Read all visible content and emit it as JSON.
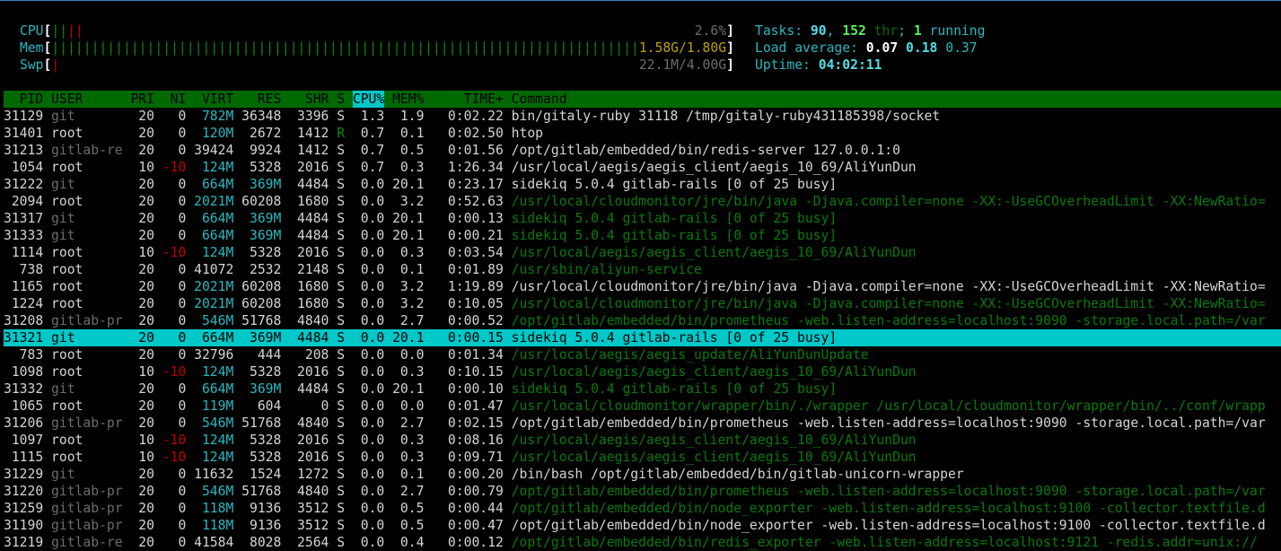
{
  "meters": [
    {
      "label": "CPU",
      "value_text": "2.6%",
      "segments": [
        {
          "percent": 1.3,
          "color": "#0a8a0a"
        },
        {
          "percent": 1.3,
          "color": "#c00000"
        }
      ]
    },
    {
      "label": "Mem",
      "value_text": "1.58G/1.80G",
      "segments": [
        {
          "percent": 88,
          "color": "#0a8a0a"
        },
        {
          "percent": 2,
          "color": "#3a78d0"
        },
        {
          "percent": 9.3,
          "color": "#c0a000"
        }
      ]
    },
    {
      "label": "Swp",
      "value_text": "22.1M/4.00G",
      "segments": [
        {
          "percent": 0.54,
          "color": "#c00000"
        }
      ]
    }
  ],
  "summary": {
    "tasks_label": "Tasks: ",
    "tasks": "90",
    "sep1": ", ",
    "threads": "152",
    "thr_label": " thr",
    "sep2": "; ",
    "running": "1",
    "running_label": " running",
    "load_label": "Load average: ",
    "load1": "0.07",
    "load5": "0.18",
    "load15": "0.37",
    "uptime_label": "Uptime: ",
    "uptime": "04:02:11"
  },
  "columns": {
    "pid": "PID",
    "user": "USER",
    "pri": "PRI",
    "ni": "NI",
    "virt": "VIRT",
    "res": "RES",
    "shr": "SHR",
    "s": "S",
    "cpu": "CPU%",
    "mem": "MEM%",
    "time": "TIME+",
    "cmd": "Command"
  },
  "sorted_column": "cpu",
  "rows": [
    {
      "pid": "31129",
      "user": "git",
      "pri": "20",
      "ni": "0",
      "virt": "782M",
      "res": "36348",
      "shr": "3396",
      "s": "S",
      "cpu": "1.3",
      "mem": "1.9",
      "time": "0:02.22",
      "cmd": "bin/gitaly-ruby 31118 /tmp/gitaly-ruby431185398/socket",
      "thread": false
    },
    {
      "pid": "31401",
      "user": "root",
      "pri": "20",
      "ni": "0",
      "virt": "120M",
      "res": "2672",
      "shr": "1412",
      "s": "R",
      "cpu": "0.7",
      "mem": "0.1",
      "time": "0:02.50",
      "cmd": "htop",
      "thread": false
    },
    {
      "pid": "31213",
      "user": "gitlab-re",
      "pri": "20",
      "ni": "0",
      "virt": "39424",
      "res": "9924",
      "shr": "1412",
      "s": "S",
      "cpu": "0.7",
      "mem": "0.5",
      "time": "0:01.56",
      "cmd": "/opt/gitlab/embedded/bin/redis-server 127.0.0.1:0",
      "thread": false
    },
    {
      "pid": "1054",
      "user": "root",
      "pri": "10",
      "ni": "-10",
      "virt": "124M",
      "res": "5328",
      "shr": "2016",
      "s": "S",
      "cpu": "0.7",
      "mem": "0.3",
      "time": "1:26.34",
      "cmd": "/usr/local/aegis/aegis_client/aegis_10_69/AliYunDun",
      "thread": false
    },
    {
      "pid": "31222",
      "user": "git",
      "pri": "20",
      "ni": "0",
      "virt": "664M",
      "res": "369M",
      "shr": "4484",
      "s": "S",
      "cpu": "0.0",
      "mem": "20.1",
      "time": "0:23.17",
      "cmd": "sidekiq 5.0.4 gitlab-rails [0 of 25 busy]",
      "thread": false
    },
    {
      "pid": "2094",
      "user": "root",
      "pri": "20",
      "ni": "0",
      "virt": "2021M",
      "res": "60208",
      "shr": "1680",
      "s": "S",
      "cpu": "0.0",
      "mem": "3.2",
      "time": "0:52.63",
      "cmd": "/usr/local/cloudmonitor/jre/bin/java -Djava.compiler=none -XX:-UseGCOverheadLimit -XX:NewRatio=",
      "thread": true
    },
    {
      "pid": "31317",
      "user": "git",
      "pri": "20",
      "ni": "0",
      "virt": "664M",
      "res": "369M",
      "shr": "4484",
      "s": "S",
      "cpu": "0.0",
      "mem": "20.1",
      "time": "0:00.13",
      "cmd": "sidekiq 5.0.4 gitlab-rails [0 of 25 busy]",
      "thread": true
    },
    {
      "pid": "31333",
      "user": "git",
      "pri": "20",
      "ni": "0",
      "virt": "664M",
      "res": "369M",
      "shr": "4484",
      "s": "S",
      "cpu": "0.0",
      "mem": "20.1",
      "time": "0:00.21",
      "cmd": "sidekiq 5.0.4 gitlab-rails [0 of 25 busy]",
      "thread": true
    },
    {
      "pid": "1114",
      "user": "root",
      "pri": "10",
      "ni": "-10",
      "virt": "124M",
      "res": "5328",
      "shr": "2016",
      "s": "S",
      "cpu": "0.0",
      "mem": "0.3",
      "time": "0:03.54",
      "cmd": "/usr/local/aegis/aegis_client/aegis_10_69/AliYunDun",
      "thread": true
    },
    {
      "pid": "738",
      "user": "root",
      "pri": "20",
      "ni": "0",
      "virt": "41072",
      "res": "2532",
      "shr": "2148",
      "s": "S",
      "cpu": "0.0",
      "mem": "0.1",
      "time": "0:01.89",
      "cmd": "/usr/sbin/aliyun-service",
      "thread": true
    },
    {
      "pid": "1165",
      "user": "root",
      "pri": "20",
      "ni": "0",
      "virt": "2021M",
      "res": "60208",
      "shr": "1680",
      "s": "S",
      "cpu": "0.0",
      "mem": "3.2",
      "time": "1:19.89",
      "cmd": "/usr/local/cloudmonitor/jre/bin/java -Djava.compiler=none -XX:-UseGCOverheadLimit -XX:NewRatio=",
      "thread": false
    },
    {
      "pid": "1224",
      "user": "root",
      "pri": "20",
      "ni": "0",
      "virt": "2021M",
      "res": "60208",
      "shr": "1680",
      "s": "S",
      "cpu": "0.0",
      "mem": "3.2",
      "time": "0:10.05",
      "cmd": "/usr/local/cloudmonitor/jre/bin/java -Djava.compiler=none -XX:-UseGCOverheadLimit -XX:NewRatio=",
      "thread": true
    },
    {
      "pid": "31208",
      "user": "gitlab-pr",
      "pri": "20",
      "ni": "0",
      "virt": "546M",
      "res": "51768",
      "shr": "4840",
      "s": "S",
      "cpu": "0.0",
      "mem": "2.7",
      "time": "0:00.52",
      "cmd": "/opt/gitlab/embedded/bin/prometheus -web.listen-address=localhost:9090 -storage.local.path=/var",
      "thread": true
    },
    {
      "pid": "31321",
      "user": "git",
      "pri": "20",
      "ni": "0",
      "virt": "664M",
      "res": "369M",
      "shr": "4484",
      "s": "S",
      "cpu": "0.0",
      "mem": "20.1",
      "time": "0:00.15",
      "cmd": "sidekiq 5.0.4 gitlab-rails [0 of 25 busy]",
      "thread": true,
      "selected": true
    },
    {
      "pid": "783",
      "user": "root",
      "pri": "20",
      "ni": "0",
      "virt": "32796",
      "res": "444",
      "shr": "208",
      "s": "S",
      "cpu": "0.0",
      "mem": "0.0",
      "time": "0:01.34",
      "cmd": "/usr/local/aegis/aegis_update/AliYunDunUpdate",
      "thread": true
    },
    {
      "pid": "1098",
      "user": "root",
      "pri": "10",
      "ni": "-10",
      "virt": "124M",
      "res": "5328",
      "shr": "2016",
      "s": "S",
      "cpu": "0.0",
      "mem": "0.3",
      "time": "0:10.15",
      "cmd": "/usr/local/aegis/aegis_client/aegis_10_69/AliYunDun",
      "thread": true
    },
    {
      "pid": "31332",
      "user": "git",
      "pri": "20",
      "ni": "0",
      "virt": "664M",
      "res": "369M",
      "shr": "4484",
      "s": "S",
      "cpu": "0.0",
      "mem": "20.1",
      "time": "0:00.10",
      "cmd": "sidekiq 5.0.4 gitlab-rails [0 of 25 busy]",
      "thread": true
    },
    {
      "pid": "1065",
      "user": "root",
      "pri": "20",
      "ni": "0",
      "virt": "119M",
      "res": "604",
      "shr": "0",
      "s": "S",
      "cpu": "0.0",
      "mem": "0.0",
      "time": "0:01.47",
      "cmd": "/usr/local/cloudmonitor/wrapper/bin/./wrapper /usr/local/cloudmonitor/wrapper/bin/../conf/wrapp",
      "thread": true
    },
    {
      "pid": "31206",
      "user": "gitlab-pr",
      "pri": "20",
      "ni": "0",
      "virt": "546M",
      "res": "51768",
      "shr": "4840",
      "s": "S",
      "cpu": "0.0",
      "mem": "2.7",
      "time": "0:02.15",
      "cmd": "/opt/gitlab/embedded/bin/prometheus -web.listen-address=localhost:9090 -storage.local.path=/var",
      "thread": false
    },
    {
      "pid": "1097",
      "user": "root",
      "pri": "10",
      "ni": "-10",
      "virt": "124M",
      "res": "5328",
      "shr": "2016",
      "s": "S",
      "cpu": "0.0",
      "mem": "0.3",
      "time": "0:08.16",
      "cmd": "/usr/local/aegis/aegis_client/aegis_10_69/AliYunDun",
      "thread": true
    },
    {
      "pid": "1115",
      "user": "root",
      "pri": "10",
      "ni": "-10",
      "virt": "124M",
      "res": "5328",
      "shr": "2016",
      "s": "S",
      "cpu": "0.0",
      "mem": "0.3",
      "time": "0:09.71",
      "cmd": "/usr/local/aegis/aegis_client/aegis_10_69/AliYunDun",
      "thread": true
    },
    {
      "pid": "31229",
      "user": "git",
      "pri": "20",
      "ni": "0",
      "virt": "11632",
      "res": "1524",
      "shr": "1272",
      "s": "S",
      "cpu": "0.0",
      "mem": "0.1",
      "time": "0:00.20",
      "cmd": "/bin/bash /opt/gitlab/embedded/bin/gitlab-unicorn-wrapper",
      "thread": false
    },
    {
      "pid": "31220",
      "user": "gitlab-pr",
      "pri": "20",
      "ni": "0",
      "virt": "546M",
      "res": "51768",
      "shr": "4840",
      "s": "S",
      "cpu": "0.0",
      "mem": "2.7",
      "time": "0:00.79",
      "cmd": "/opt/gitlab/embedded/bin/prometheus -web.listen-address=localhost:9090 -storage.local.path=/var",
      "thread": true
    },
    {
      "pid": "31259",
      "user": "gitlab-pr",
      "pri": "20",
      "ni": "0",
      "virt": "118M",
      "res": "9136",
      "shr": "3512",
      "s": "S",
      "cpu": "0.0",
      "mem": "0.5",
      "time": "0:00.44",
      "cmd": "/opt/gitlab/embedded/bin/node_exporter -web.listen-address=localhost:9100 -collector.textfile.d",
      "thread": true
    },
    {
      "pid": "31190",
      "user": "gitlab-pr",
      "pri": "20",
      "ni": "0",
      "virt": "118M",
      "res": "9136",
      "shr": "3512",
      "s": "S",
      "cpu": "0.0",
      "mem": "0.5",
      "time": "0:00.47",
      "cmd": "/opt/gitlab/embedded/bin/node_exporter -web.listen-address=localhost:9100 -collector.textfile.d",
      "thread": false
    },
    {
      "pid": "31219",
      "user": "gitlab-re",
      "pri": "20",
      "ni": "0",
      "virt": "41584",
      "res": "8028",
      "shr": "2564",
      "s": "S",
      "cpu": "0.0",
      "mem": "0.4",
      "time": "0:00.12",
      "cmd": "/opt/gitlab/embedded/bin/redis_exporter -web.listen-address=localhost:9121 -redis.addr=unix://",
      "thread": true
    }
  ]
}
